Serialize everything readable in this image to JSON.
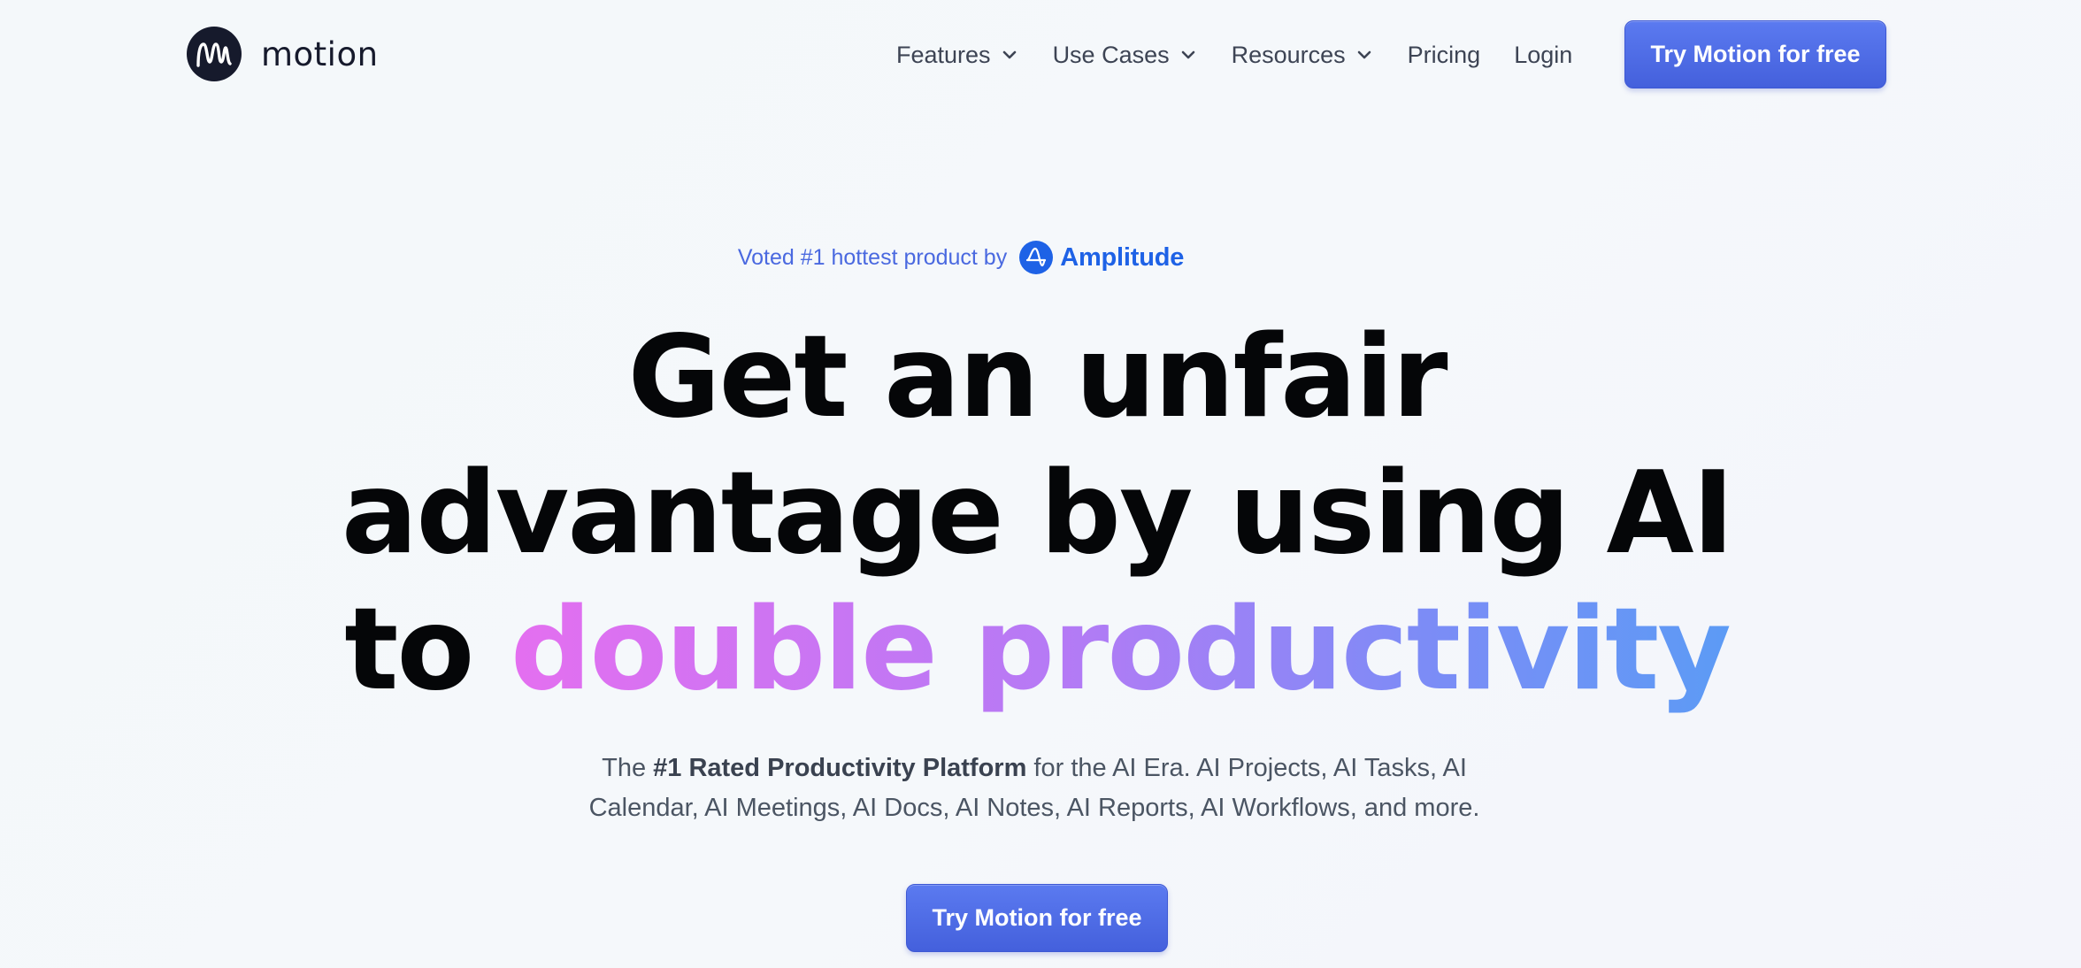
{
  "brand": {
    "name": "motion",
    "logo_icon": "motion-m-logo-icon",
    "dark_color": "#161a2c"
  },
  "nav": {
    "items": [
      {
        "label": "Features",
        "has_dropdown": true
      },
      {
        "label": "Use Cases",
        "has_dropdown": true
      },
      {
        "label": "Resources",
        "has_dropdown": true
      },
      {
        "label": "Pricing",
        "has_dropdown": false
      },
      {
        "label": "Login",
        "has_dropdown": false
      }
    ],
    "cta_label": "Try Motion for free"
  },
  "hero": {
    "voted_text": "Voted #1 hottest product by",
    "partner_name": "Amplitude",
    "partner_icon": "amplitude-logo-icon",
    "headline": {
      "line1": "Get an unfair",
      "line2": "advantage by using AI",
      "line3_prefix": "to ",
      "line3_highlight": "double productivity"
    },
    "subtext": {
      "part1": "The ",
      "bold": "#1 Rated Productivity Platform",
      "part2": " for the AI Era. AI Projects, AI Tasks, AI",
      "line2": "Calendar, AI Meetings, AI Docs, AI Notes, AI Reports, AI Workflows, and more."
    },
    "cta_label": "Try Motion for free"
  },
  "colors": {
    "primary_button": "#4a66e0",
    "amplitude_blue": "#1e62e6",
    "gradient_start": "#e46ff0",
    "gradient_end": "#5c9bf5"
  }
}
